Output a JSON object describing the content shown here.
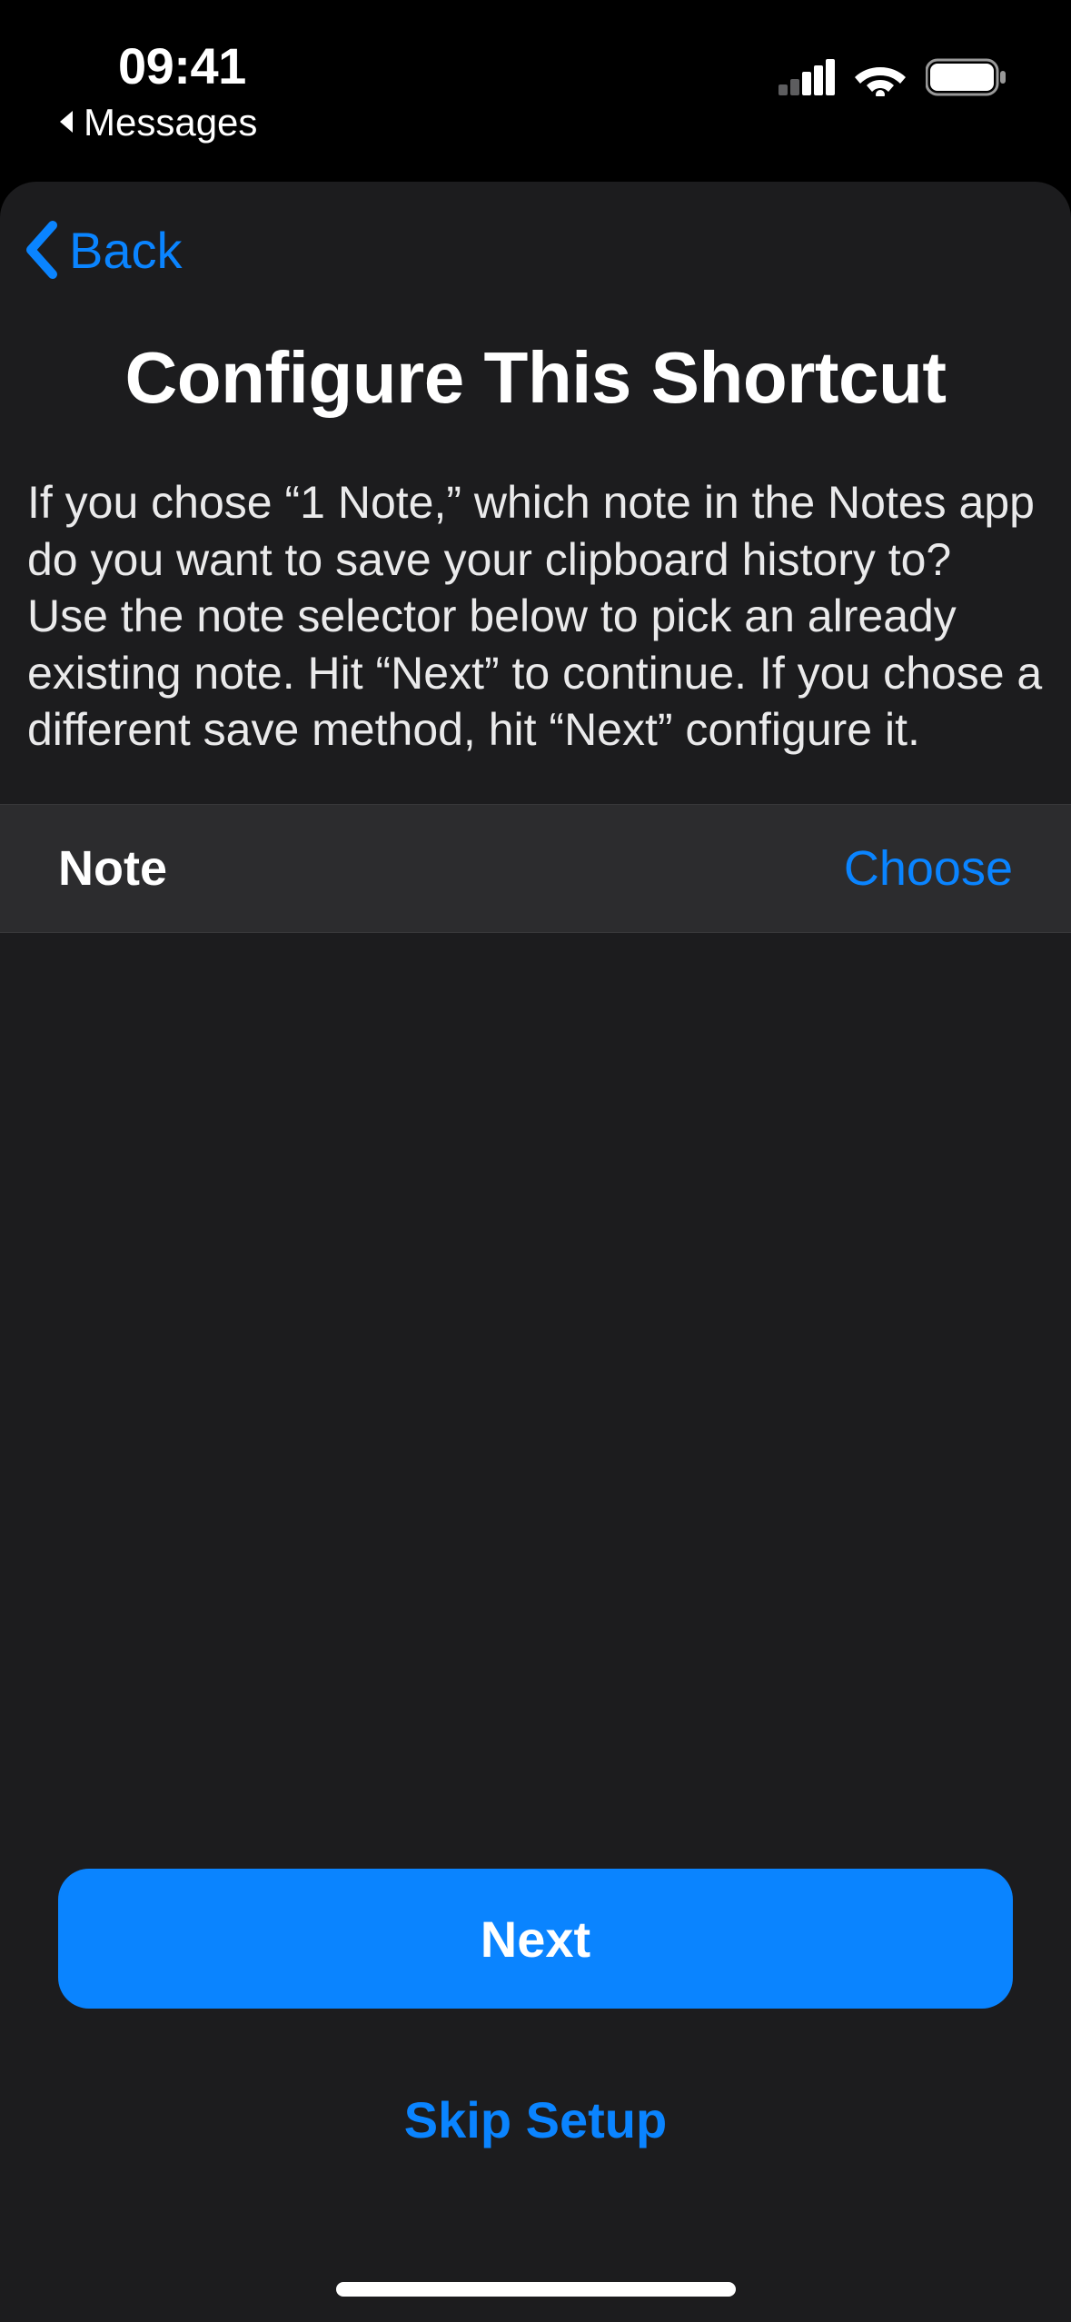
{
  "status": {
    "time": "09:41",
    "breadcrumb_app": "Messages"
  },
  "nav": {
    "back_label": "Back"
  },
  "page": {
    "title": "Configure This Shortcut",
    "description": "If you chose “1 Note,” which note in the Notes app do you want to save your clipboard history to? Use the note selector below to pick an already existing note. Hit “Next” to continue. If you chose a different save method, hit “Next” configure it."
  },
  "row": {
    "label": "Note",
    "action": "Choose"
  },
  "buttons": {
    "primary": "Next",
    "secondary": "Skip Setup"
  },
  "colors": {
    "accent": "#0a84ff",
    "sheet_bg": "#1c1c1e",
    "row_bg": "#2c2c2e"
  }
}
